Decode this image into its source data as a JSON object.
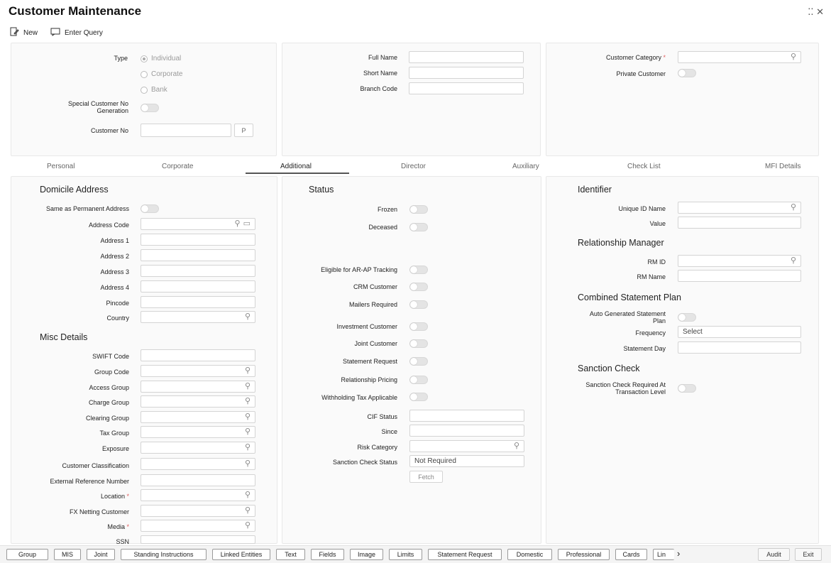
{
  "window": {
    "title": "Customer Maintenance",
    "controls": "⁚⁚ ✕"
  },
  "toolbar": {
    "new_label": "New",
    "enter_query_label": "Enter Query"
  },
  "header": {
    "type_label": "Type",
    "type_options": [
      "Individual",
      "Corporate",
      "Bank"
    ],
    "special_customer_label_1": "Special Customer No",
    "special_customer_label_2": "Generation",
    "customer_no_label": "Customer No",
    "customer_no_button": "P",
    "full_name_label": "Full Name",
    "short_name_label": "Short Name",
    "branch_code_label": "Branch Code",
    "customer_category_label": "Customer Category",
    "private_customer_label": "Private Customer"
  },
  "tabs": [
    "Personal",
    "Corporate",
    "Additional",
    "Director",
    "Auxiliary",
    "Check List",
    "MFI Details"
  ],
  "domicile": {
    "title": "Domicile Address",
    "same_as_permanent": "Same as Permanent Address",
    "address_code": "Address Code",
    "address1": "Address 1",
    "address2": "Address 2",
    "address3": "Address 3",
    "address4": "Address 4",
    "pincode": "Pincode",
    "country": "Country"
  },
  "misc": {
    "title": "Misc Details",
    "swift_code": "SWIFT Code",
    "group_code": "Group Code",
    "access_group": "Access Group",
    "charge_group": "Charge Group",
    "clearing_group": "Clearing Group",
    "tax_group": "Tax Group",
    "exposure": "Exposure",
    "customer_classification": "Customer Classification",
    "external_ref": "External Reference Number",
    "location": "Location",
    "fx_netting": "FX Netting Customer",
    "media": "Media",
    "ssn": "SSN"
  },
  "status": {
    "title": "Status",
    "frozen": "Frozen",
    "deceased": "Deceased",
    "eligible_arap": "Eligible for AR-AP Tracking",
    "crm_customer": "CRM Customer",
    "mailers_required": "Mailers Required",
    "investment_customer": "Investment Customer",
    "joint_customer": "Joint Customer",
    "statement_request": "Statement Request",
    "relationship_pricing": "Relationship Pricing",
    "withholding_tax": "Withholding Tax Applicable",
    "cif_status": "CIF Status",
    "since": "Since",
    "risk_category": "Risk Category",
    "sanction_check_status": "Sanction Check Status",
    "sanction_check_status_value": "Not Required",
    "fetch_button": "Fetch"
  },
  "identifier": {
    "title": "Identifier",
    "unique_id_name": "Unique ID Name",
    "value": "Value"
  },
  "relationship_manager": {
    "title": "Relationship Manager",
    "rm_id": "RM ID",
    "rm_name": "RM Name"
  },
  "combined_statement": {
    "title": "Combined Statement Plan",
    "auto_generated_1": "Auto Generated Statement",
    "auto_generated_2": "Plan",
    "frequency": "Frequency",
    "frequency_value": "Select",
    "statement_day": "Statement Day"
  },
  "sanction_check": {
    "title": "Sanction Check",
    "required_1": "Sanction Check Required At",
    "required_2": "Transaction Level"
  },
  "bottom_buttons": [
    "Group",
    "MIS",
    "Joint",
    "Standing Instructions",
    "Linked Entities",
    "Text",
    "Fields",
    "Image",
    "Limits",
    "Statement Request",
    "Domestic",
    "Professional",
    "Cards",
    "Lin"
  ],
  "bottom_more": "›",
  "bottom_right": {
    "audit": "Audit",
    "exit": "Exit"
  }
}
